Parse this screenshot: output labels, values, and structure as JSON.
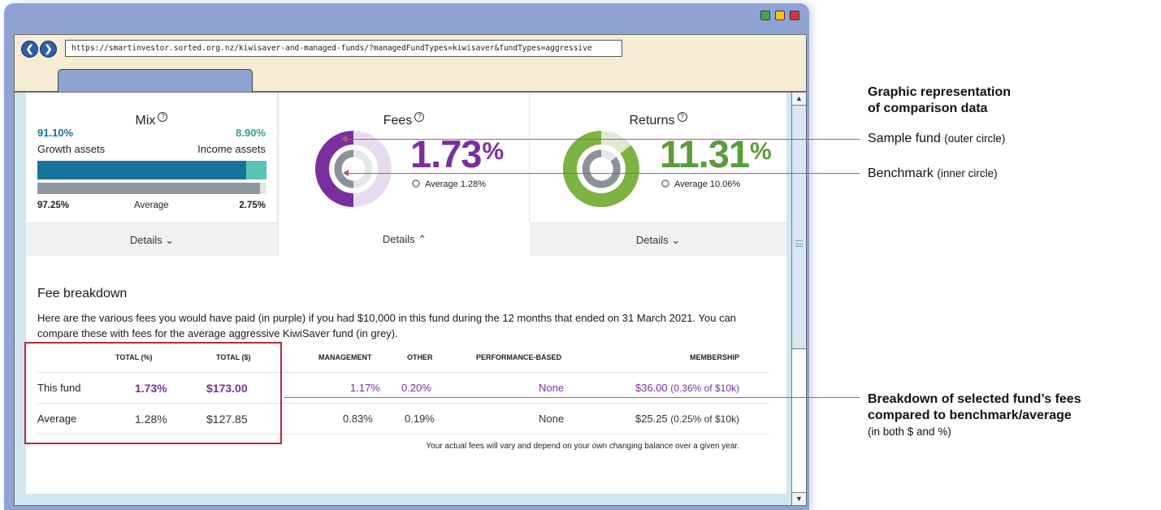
{
  "browser": {
    "url": "https://smartinvestor.sorted.org.nz/kiwisaver-and-managed-funds/?managedFundTypes=kiwisaver&fundTypes=aggressive",
    "back_glyph": "❮",
    "forward_glyph": "❯"
  },
  "colors": {
    "purple": "#7b2f9e",
    "green": "#5a9b3a",
    "teal": "#14749e",
    "teal_light": "#59c3b7",
    "highlight": "#b22a3c"
  },
  "mix": {
    "title": "Mix",
    "growth_value": "91.10%",
    "income_value": "8.90%",
    "growth_label": "Growth assets",
    "income_label": "Income assets",
    "avg_growth": "97.25%",
    "avg_label": "Average",
    "avg_income": "2.75%",
    "fund_growth_fraction": 0.911,
    "avg_growth_fraction": 0.9725,
    "details": "Details ⌄"
  },
  "fees": {
    "title": "Fees",
    "value": "1.73",
    "pct": "%",
    "avg_text": "Average 1.28%",
    "details": "Details ⌃"
  },
  "returns": {
    "title": "Returns",
    "value": "11.31",
    "pct": "%",
    "avg_text": "Average 10.06%",
    "details": "Details ⌄"
  },
  "fee_breakdown": {
    "title": "Fee breakdown",
    "description": "Here are the various fees you would have paid (in purple) if you had $10,000 in this fund during the 12 months that ended on 31 March 2021. You can compare these with fees for the average aggressive KiwiSaver fund (in grey).",
    "headers": [
      "TOTAL (%)",
      "TOTAL ($)",
      "MANAGEMENT",
      "OTHER",
      "PERFORMANCE-BASED",
      "MEMBERSHIP"
    ],
    "rows": [
      {
        "label": "This fund",
        "total_pct": "1.73%",
        "total_dollar": "$173.00",
        "management": "1.17%",
        "other": "0.20%",
        "performance": "None",
        "membership": "$36.00",
        "membership_note": "(0.36% of $10k)"
      },
      {
        "label": "Average",
        "total_pct": "1.28%",
        "total_dollar": "$127.85",
        "management": "0.83%",
        "other": "0.19%",
        "performance": "None",
        "membership": "$25.25",
        "membership_note": "(0.25% of $10k)"
      }
    ],
    "note": "Your actual fees will vary and depend on your own changing balance over a given year."
  },
  "annotations": {
    "graphic_title_1": "Graphic representation",
    "graphic_title_2": "of comparison data",
    "sample_fund": "Sample fund",
    "sample_fund_note": "(outer circle)",
    "benchmark": "Benchmark",
    "benchmark_note": "(inner circle)",
    "breakdown_1": "Breakdown of selected fund’s fees",
    "breakdown_2": "compared to benchmark/average",
    "breakdown_note": "(in both $ and %)"
  }
}
